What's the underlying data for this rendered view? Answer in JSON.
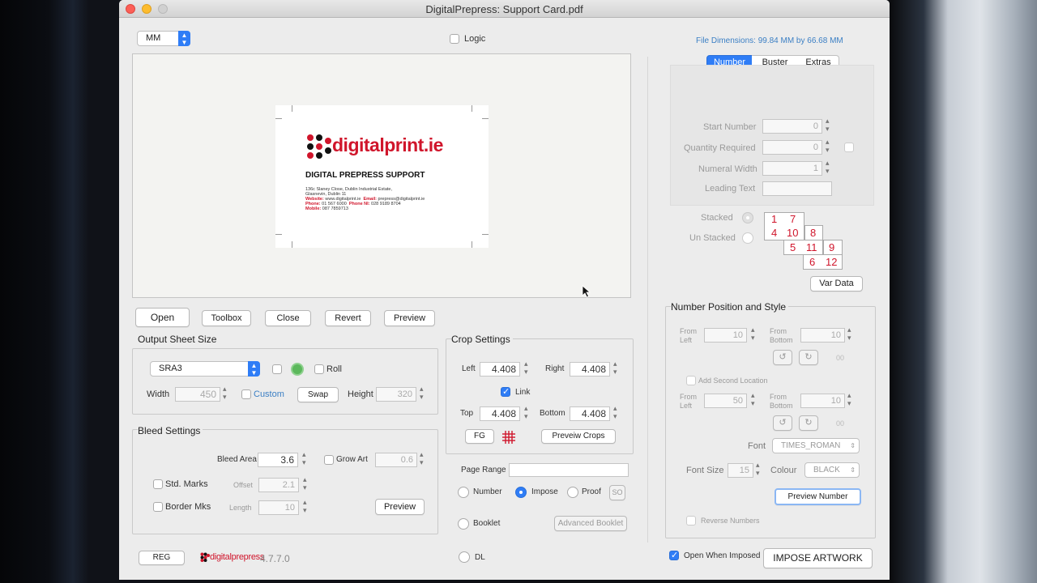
{
  "window": {
    "title": "DigitalPrepress: Support Card.pdf"
  },
  "top": {
    "units": "MM",
    "logic_label": "Logic",
    "file_dimensions": "File Dimensions: 99.84 MM by 66.68 MM"
  },
  "preview_card": {
    "logo_text": "digitalprint.ie",
    "heading": "DIGITAL PREPRESS SUPPORT",
    "address1": "136c Slaney Close, Dublin Industrial Estate,",
    "address2": "Glasnevin, Dublin 11",
    "website_label": "Website:",
    "website": "www.digitalprint.ie",
    "email_label": "Email:",
    "email": "prepress@digitalprint.ie",
    "phone_label": "Phone:",
    "phone": "01 567 6000",
    "phone_ni_label": "Phone NI:",
    "phone_ni": "028 9189 8704",
    "mobile_label": "Mobile:",
    "mobile": "087 7859713"
  },
  "toolbar": {
    "open": "Open",
    "toolbox": "Toolbox",
    "close": "Close",
    "revert": "Revert",
    "preview": "Preview"
  },
  "output_sheet": {
    "title": "Output Sheet Size",
    "size": "SRA3",
    "roll_label": "Roll",
    "width_label": "Width",
    "width": "450",
    "custom_label": "Custom",
    "swap": "Swap",
    "height_label": "Height",
    "height": "320"
  },
  "bleed": {
    "title": "Bleed Settings",
    "bleed_area_label": "Bleed Area",
    "bleed_area": "3.6",
    "grow_art_label": "Grow Art",
    "grow_art": "0.6",
    "std_marks_label": "Std. Marks",
    "offset_label": "Offset",
    "offset": "2.1",
    "border_mks_label": "Border Mks",
    "length_label": "Length",
    "length": "10",
    "preview": "Preview"
  },
  "crop": {
    "title": "Crop Settings",
    "left_label": "Left",
    "left": "4.408",
    "right_label": "Right",
    "right": "4.408",
    "link_label": "Link",
    "top_label": "Top",
    "top": "4.408",
    "bottom_label": "Bottom",
    "bottom": "4.408",
    "fg": "FG",
    "preview_crops": "Preveiw Crops"
  },
  "page_range": {
    "label": "Page Range",
    "number_label": "Number",
    "impose_label": "Impose",
    "proof_label": "Proof",
    "so": "SO",
    "booklet_label": "Booklet",
    "advanced_booklet": "Advanced Booklet",
    "dl_label": "DL"
  },
  "footer": {
    "reg": "REG",
    "brand": "digitalprepress",
    "version": "4.7.7.0"
  },
  "tabs": [
    "Number",
    "Buster",
    "Extras"
  ],
  "numbering": {
    "start_number_label": "Start Number",
    "start_number": "0",
    "quantity_label": "Quantity Required",
    "quantity": "0",
    "numeral_width_label": "Numeral Width",
    "numeral_width": "1",
    "leading_text_label": "Leading Text",
    "stacked_label": "Stacked",
    "unstacked_label": "Un Stacked",
    "stack_numbers": [
      "1",
      "7",
      "4",
      "10",
      "8",
      "5",
      "11",
      "9",
      "6",
      "12"
    ],
    "var_data": "Var Data"
  },
  "position": {
    "title": "Number Position and Style",
    "from_left_label": "From\nLeft",
    "from_left1": "10",
    "from_bottom_label": "From\nBottom",
    "from_bottom1": "10",
    "oo1": "00",
    "add_second_label": "Add Second Location",
    "from_left2": "50",
    "from_bottom2": "10",
    "oo2": "00",
    "font_label": "Font",
    "font": "TIMES_ROMAN",
    "font_size_label": "Font Size",
    "font_size": "15",
    "colour_label": "Colour",
    "colour": "BLACK",
    "preview_number": "Preview Number",
    "reverse_label": "Reverse Numbers"
  },
  "bottom_right": {
    "open_when_imposed": "Open When Imposed",
    "impose": "IMPOSE ARTWORK"
  },
  "colors": {
    "accent": "#2f7df6",
    "brand_red": "#d0152b",
    "link_blue": "#3b7fc4"
  }
}
